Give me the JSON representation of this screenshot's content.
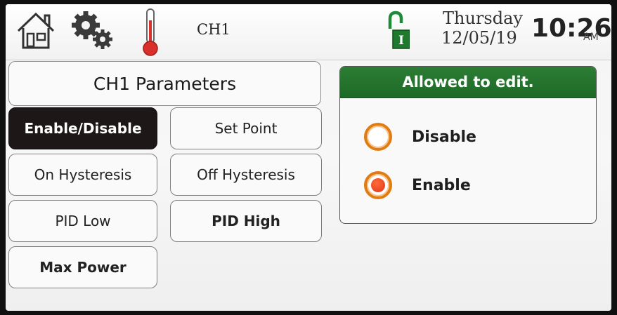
{
  "header": {
    "channel": "CH1",
    "day": "Thursday",
    "date": "12/05/19",
    "time": "10:26",
    "ampm": "AM"
  },
  "params": {
    "title": "CH1 Parameters",
    "buttons": [
      {
        "label": "Enable/Disable",
        "active": true
      },
      {
        "label": "Set Point"
      },
      {
        "label": "On Hysteresis"
      },
      {
        "label": "Off Hysteresis"
      },
      {
        "label": "PID Low"
      },
      {
        "label": "PID High"
      },
      {
        "label": "Max Power"
      }
    ]
  },
  "edit_panel": {
    "header": "Allowed to edit.",
    "options": [
      {
        "label": "Disable",
        "selected": false
      },
      {
        "label": "Enable",
        "selected": true
      }
    ]
  },
  "colors": {
    "accent_green": "#1f6e29",
    "radio_orange": "#e07c12",
    "active_button": "#1d1717"
  },
  "icons": [
    "home-icon",
    "gear-icon",
    "thermometer-icon",
    "lock-icon"
  ]
}
